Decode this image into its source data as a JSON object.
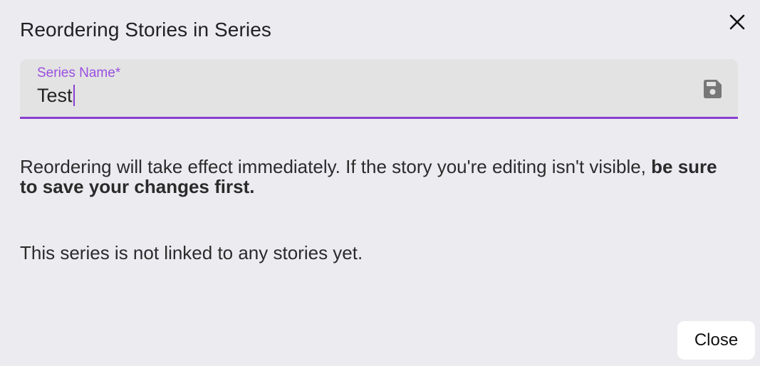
{
  "dialog": {
    "title": "Reordering Stories in Series",
    "close_icon": "close-icon"
  },
  "series_name_field": {
    "label": "Series Name*",
    "value": "Test",
    "save_icon": "save-floppy-icon",
    "accent_color": "#8a3fd1"
  },
  "notice": {
    "text": "Reordering will take effect immediately. If the story you're editing isn't visible, ",
    "bold_text": "be sure to save your changes first."
  },
  "empty_state": {
    "text": "This series is not linked to any stories yet."
  },
  "footer": {
    "close_label": "Close"
  }
}
